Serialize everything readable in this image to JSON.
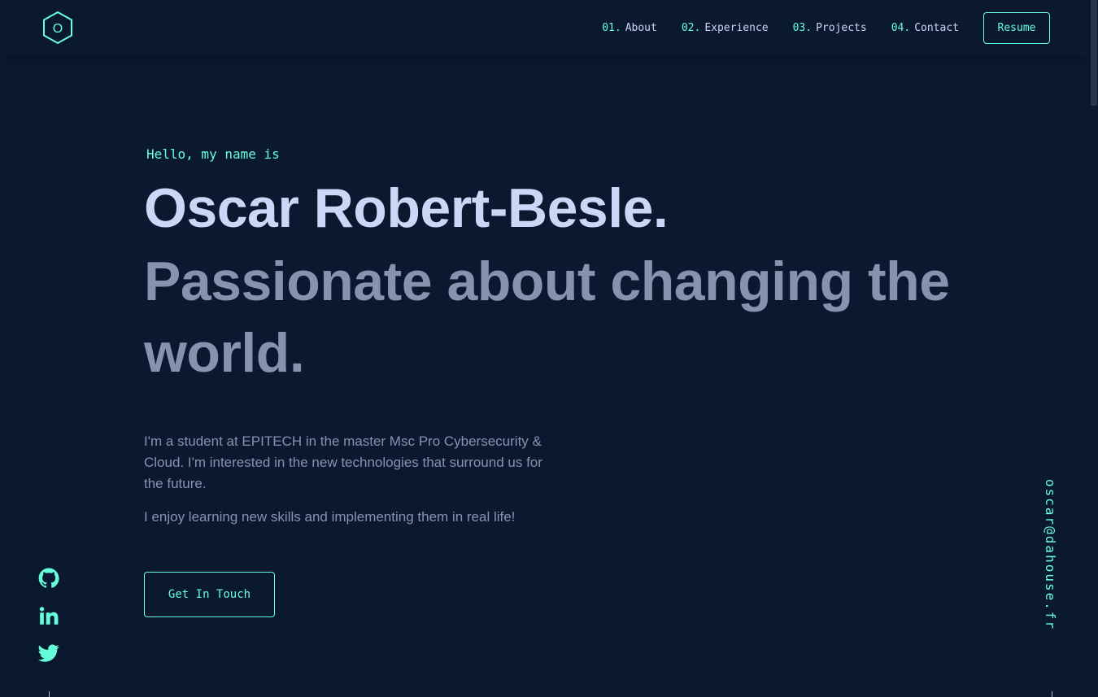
{
  "header": {
    "logo_letter": "O",
    "nav": [
      {
        "num": "01.",
        "label": "About"
      },
      {
        "num": "02.",
        "label": "Experience"
      },
      {
        "num": "03.",
        "label": "Projects"
      },
      {
        "num": "04.",
        "label": "Contact"
      }
    ],
    "resume_label": "Resume"
  },
  "hero": {
    "greeting": "Hello, my name is",
    "name": "Oscar Robert-Besle.",
    "tagline": "Passionate about changing the world.",
    "bio": [
      "I'm a student at EPITECH in the master Msc Pro Cybersecurity & Cloud. I'm interested in the new technologies that surround us for the future.",
      "I enjoy learning new skills and implementing them in real life!"
    ],
    "cta_label": "Get In Touch"
  },
  "social": [
    {
      "icon": "github-icon"
    },
    {
      "icon": "linkedin-icon"
    },
    {
      "icon": "twitter-icon"
    }
  ],
  "email": "oscar@dahouse.fr",
  "colors": {
    "background": "#0a192f",
    "accent": "#64ffda",
    "heading": "#ccd6f6",
    "text": "#8892b0"
  }
}
